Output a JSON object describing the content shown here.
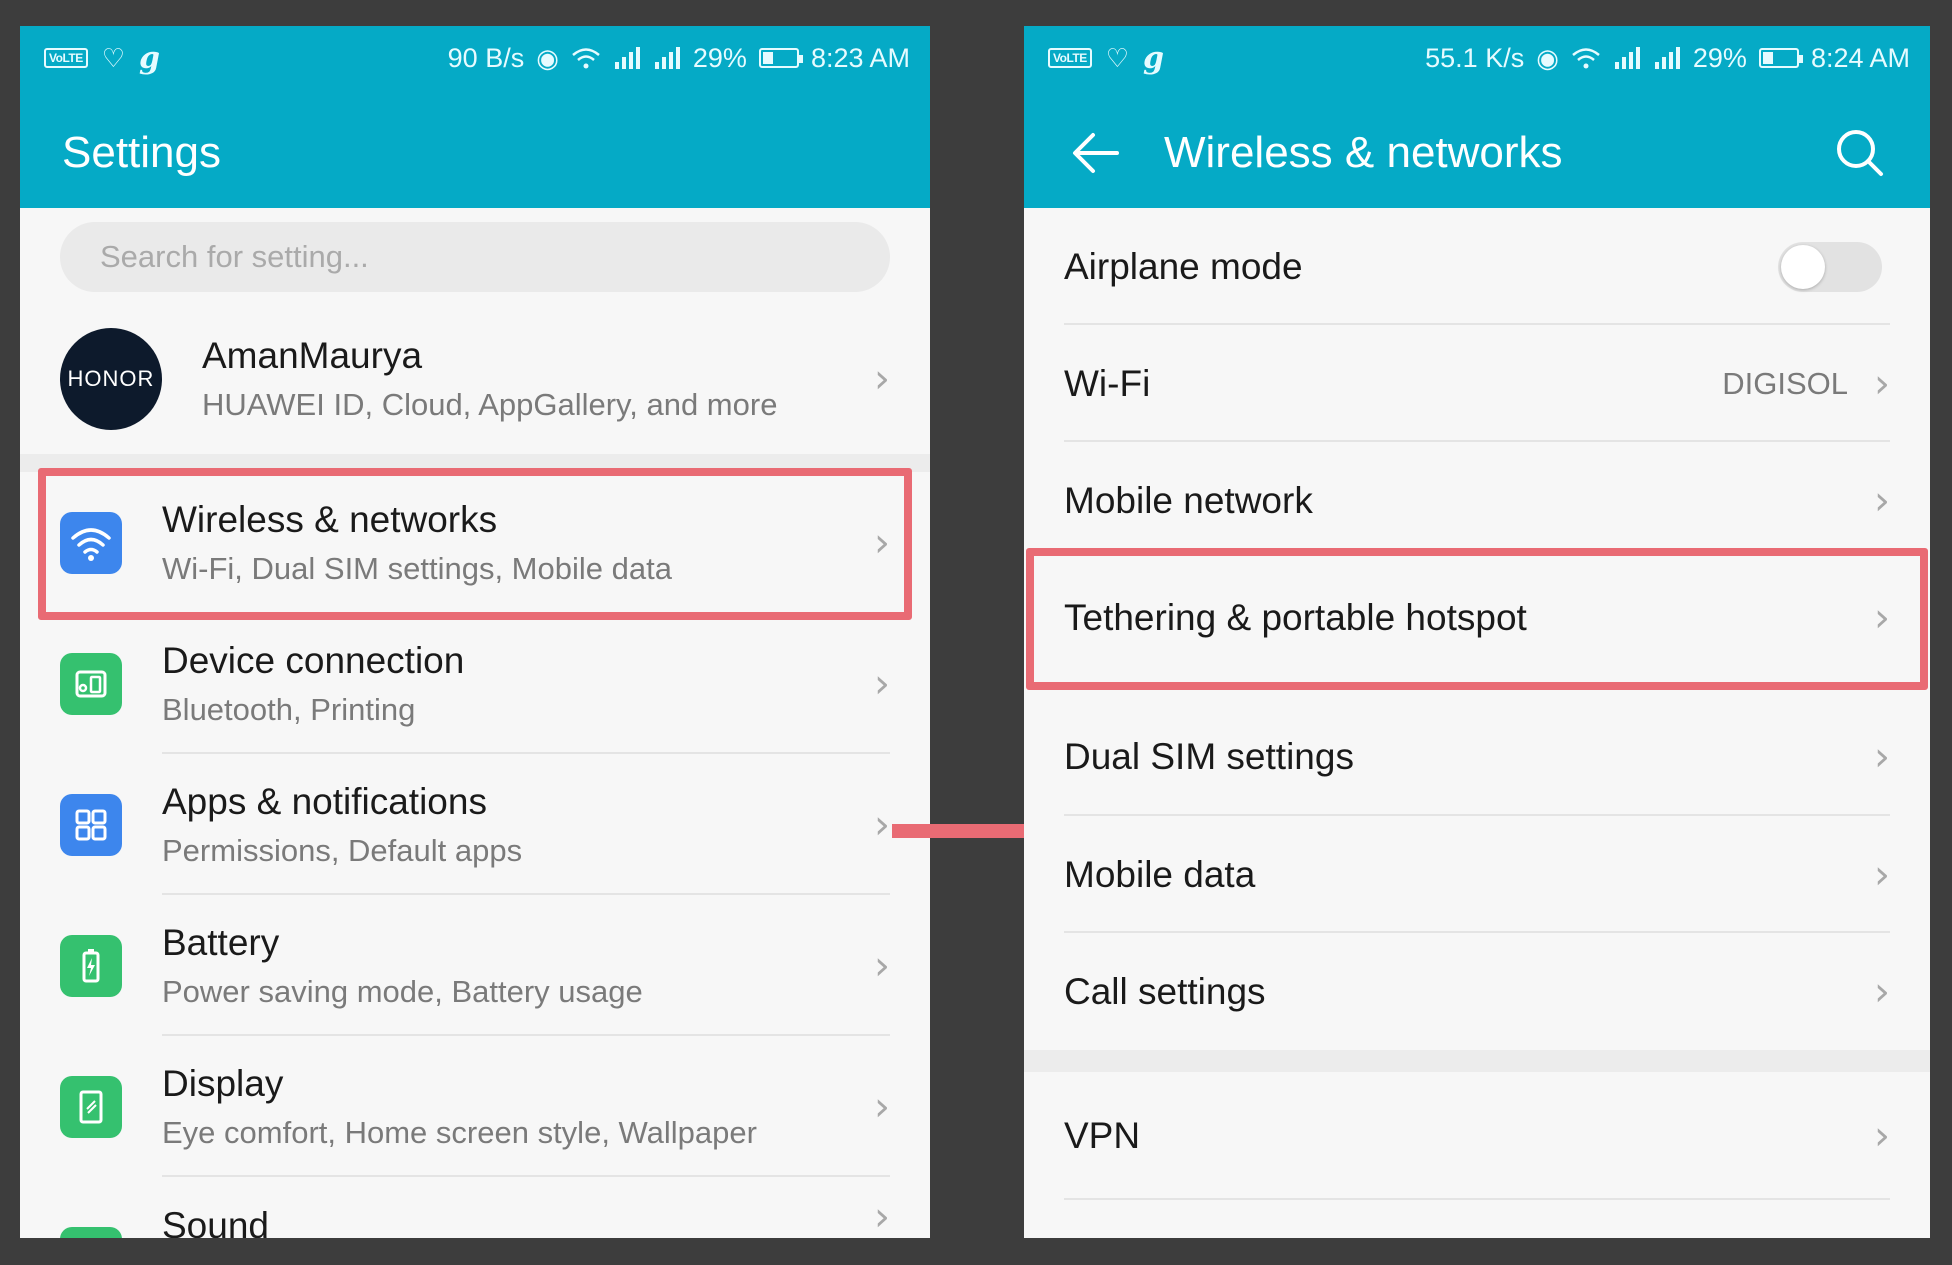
{
  "left": {
    "status": {
      "speed": "90 B/s",
      "battery": "29%",
      "time": "8:23 AM",
      "volte": "VoLTE"
    },
    "title": "Settings",
    "search_placeholder": "Search for setting...",
    "account": {
      "avatar_text": "HONOR",
      "name": "AmanMaurya",
      "subtitle": "HUAWEI ID, Cloud, AppGallery, and more"
    },
    "items": [
      {
        "title": "Wireless & networks",
        "subtitle": "Wi-Fi, Dual SIM settings, Mobile data",
        "icon": "wifi-icon",
        "color": "#3d86ed"
      },
      {
        "title": "Device connection",
        "subtitle": "Bluetooth, Printing",
        "icon": "device-connection-icon",
        "color": "#35c16f"
      },
      {
        "title": "Apps & notifications",
        "subtitle": "Permissions, Default apps",
        "icon": "apps-grid-icon",
        "color": "#3d86ed"
      },
      {
        "title": "Battery",
        "subtitle": "Power saving mode, Battery usage",
        "icon": "battery-icon",
        "color": "#35c16f"
      },
      {
        "title": "Display",
        "subtitle": "Eye comfort, Home screen style, Wallpaper",
        "icon": "display-icon",
        "color": "#35c16f"
      },
      {
        "title": "Sound",
        "subtitle": "",
        "icon": "sound-icon",
        "color": "#35c16f"
      }
    ]
  },
  "right": {
    "status": {
      "speed": "55.1 K/s",
      "battery": "29%",
      "time": "8:24 AM",
      "volte": "VoLTE"
    },
    "title": "Wireless & networks",
    "rows": [
      {
        "label": "Airplane mode",
        "toggle": false
      },
      {
        "label": "Wi-Fi",
        "value": "DIGISOL"
      },
      {
        "label": "Mobile network"
      },
      {
        "label": "Tethering & portable hotspot"
      },
      {
        "label": "Dual SIM settings"
      },
      {
        "label": "Mobile data"
      },
      {
        "label": "Call settings"
      },
      {
        "label": "VPN"
      }
    ]
  },
  "colors": {
    "appbar": "#05aac6",
    "highlight": "#e96b74",
    "background": "#3d3d3d"
  }
}
